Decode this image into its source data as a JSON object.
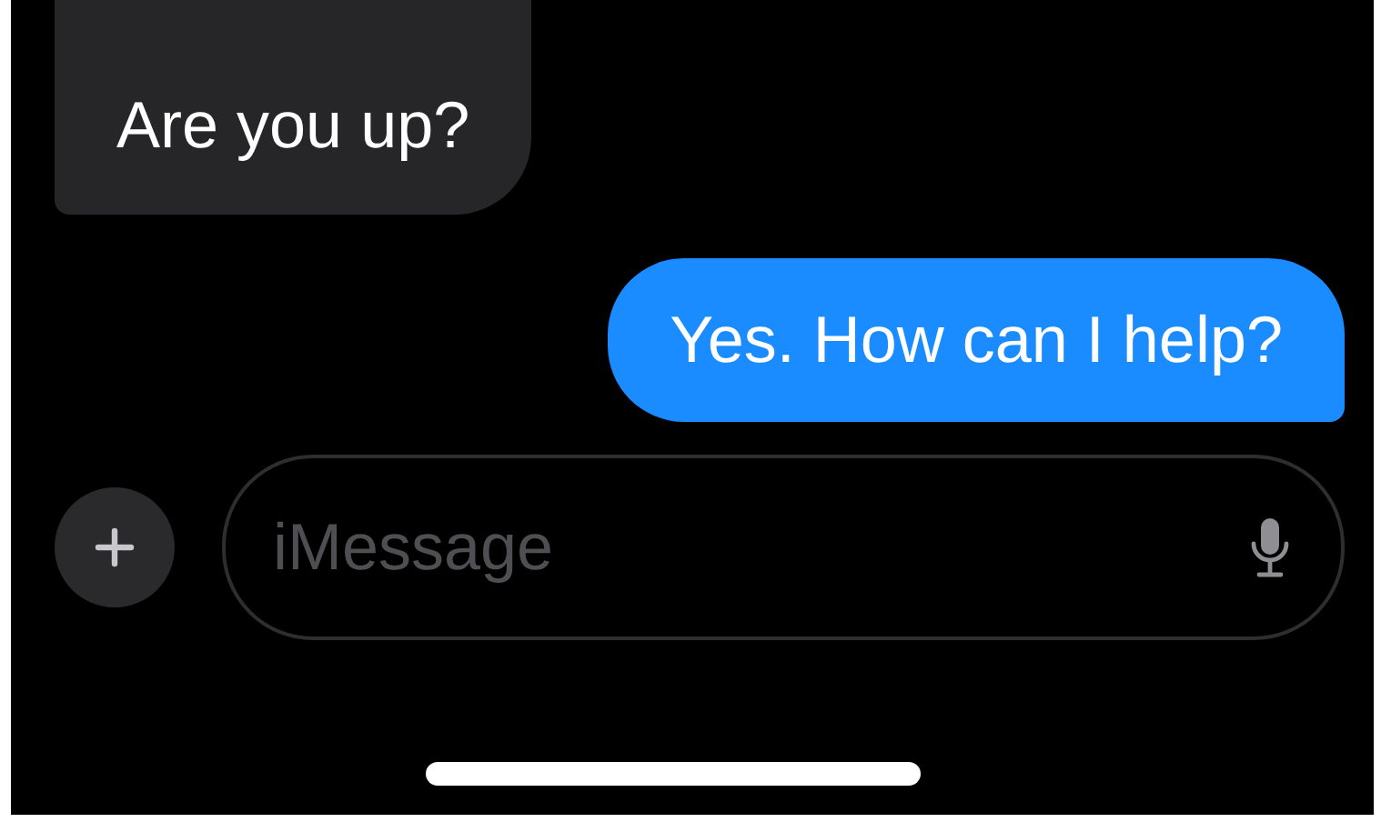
{
  "messages": [
    {
      "kind": "incoming",
      "text": "Are you up?"
    },
    {
      "kind": "outgoing",
      "text": "Yes. How can I help?"
    }
  ],
  "composer": {
    "placeholder": "iMessage"
  }
}
